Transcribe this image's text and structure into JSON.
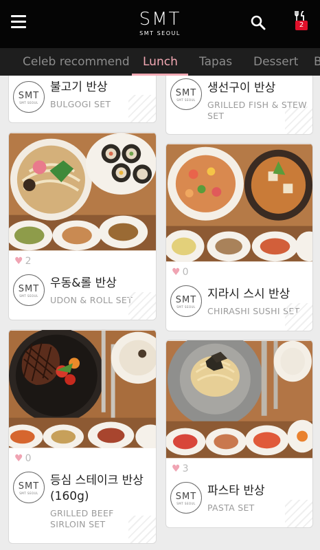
{
  "header": {
    "logo_mark": "SMT",
    "logo_sub": "SMT SEOUL",
    "cart_count": "2"
  },
  "tabs": [
    {
      "label": "Celeb recommend"
    },
    {
      "label": "Lunch"
    },
    {
      "label": "Tapas"
    },
    {
      "label": "Dessert"
    },
    {
      "label": "B"
    }
  ],
  "brand_badge": {
    "mark": "SMT",
    "sub": "SMT SEOUL"
  },
  "cards": [
    {
      "korean": "불고기 반상",
      "english": "BULGOGI SET",
      "likes": ""
    },
    {
      "korean": "생선구이 반상",
      "english_1": "GRILLED FISH & STEW",
      "english_2": "SET",
      "likes": ""
    },
    {
      "korean": "우동&롤 반상",
      "english": "UDON & ROLL SET",
      "likes": "2"
    },
    {
      "korean": "지라시 스시 반상",
      "english": "CHIRASHI SUSHI SET",
      "likes": "0"
    },
    {
      "korean_1": "등심 스테이크 반상",
      "korean_2": "(160g)",
      "english_1": "GRILLED BEEF",
      "english_2": "SIRLOIN SET",
      "likes": "0"
    },
    {
      "korean": "파스타 반상",
      "english": "PASTA SET",
      "likes": "3"
    }
  ]
}
